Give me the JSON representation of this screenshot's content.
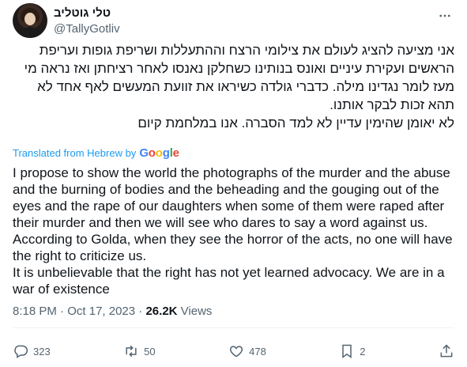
{
  "author": {
    "display_name": "טלי גוטליב",
    "handle": "@TallyGotliv"
  },
  "tweet": {
    "hebrew_paragraph_1": "אני מציעה להציג לעולם את צילומי הרצח וההתעללות ושריפת גופות ועריפת הראשים ועקירת עיניים ואונס בנותינו כשחלקן נאנסו לאחר רציחתן ואז נראה מי מעז לומר נגדינו מילה. כדברי גולדה כשיראו את זוועת המעשים לאף אחד לא תהא זכות לבקר אותנו.",
    "hebrew_paragraph_2": "לא יאומן שהימין עדיין לא למד הסברה. אנו במלחמת קיום",
    "translated_label": "Translated from Hebrew by",
    "translator_logo": {
      "g1": "G",
      "o1": "o",
      "o2": "o",
      "g2": "g",
      "l": "l",
      "e": "e"
    },
    "english_paragraph_1": "I propose to show the world the photographs of the murder and the abuse and the burning of bodies and the beheading and the gouging out of the eyes and the rape of our daughters when some of them were raped after their murder and then we will see who dares to say a word against us. According to Golda, when they see the horror of the acts, no one will have the right to criticize us.",
    "english_paragraph_2": "It is unbelievable that the right has not yet learned advocacy. We are in a war of existence",
    "time": "8:18 PM",
    "separator": "·",
    "date": "Oct 17, 2023",
    "views_count": "26.2K",
    "views_label": "Views"
  },
  "actions": {
    "reply_count": "323",
    "retweet_count": "50",
    "like_count": "478",
    "bookmark_count": "2"
  },
  "icons": {
    "more": "more-horizontal-icon",
    "reply": "reply-icon",
    "retweet": "retweet-icon",
    "like": "heart-icon",
    "bookmark": "bookmark-icon",
    "share": "share-icon"
  },
  "colors": {
    "link_blue": "#1d9bf0",
    "muted": "#536471",
    "text": "#0f1419"
  }
}
